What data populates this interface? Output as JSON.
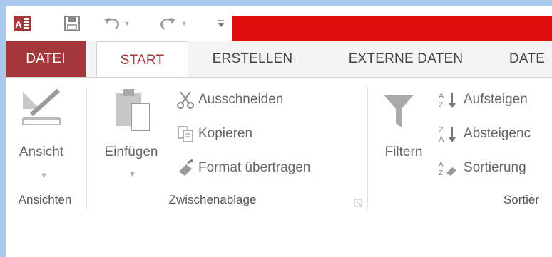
{
  "qat": {
    "app_icon": "access-icon",
    "app_icon_text": "A",
    "save_icon": "save-icon",
    "undo_icon": "undo-icon",
    "redo_icon": "redo-icon",
    "customize_icon": "customize-qat-icon",
    "title_bar_color": "#e00d0d"
  },
  "tabs": [
    {
      "label": "DATEI"
    },
    {
      "label": "START"
    },
    {
      "label": "ERSTELLEN"
    },
    {
      "label": "EXTERNE DATEN"
    },
    {
      "label": "DATE"
    }
  ],
  "ribbon": {
    "views": {
      "button_label": "Ansicht",
      "group_label": "Ansichten",
      "icon": "design-view-icon"
    },
    "clipboard": {
      "paste_label": "Einfügen",
      "paste_icon": "paste-icon",
      "cut_label": "Ausschneiden",
      "cut_icon": "scissors-icon",
      "copy_label": "Kopieren",
      "copy_icon": "copy-icon",
      "format_label": "Format übertragen",
      "format_icon": "format-painter-icon",
      "group_label": "Zwischenablage"
    },
    "sort_filter": {
      "filter_label": "Filtern",
      "filter_icon": "filter-icon",
      "asc_label": "Aufsteigen",
      "asc_icon": "sort-ascending-icon",
      "desc_label": "Absteigenc",
      "desc_icon": "sort-descending-icon",
      "clear_label": "Sortierung",
      "clear_icon": "clear-sort-icon",
      "group_label": "Sortier"
    }
  },
  "colors": {
    "accent": "#a4373a",
    "frame": "#a9cbeb"
  }
}
